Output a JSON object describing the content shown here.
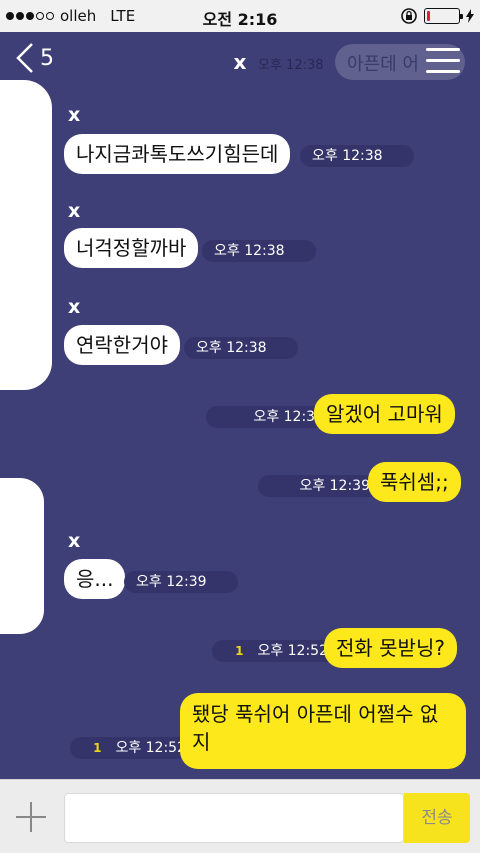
{
  "status_bar": {
    "carrier": "olleh",
    "network": "LTE",
    "time": "오전 2:16",
    "signal_bars": 3,
    "battery_level": 0.1,
    "battery_color": "#e0212a"
  },
  "header": {
    "back_count": "5",
    "title": "x",
    "ghost_text": "아픈데 어",
    "ghost_time": "오후 12:38"
  },
  "messages": [
    {
      "dir": "in",
      "sender": "x",
      "text": "나지금콰톡도쓰기힘든데",
      "time": "오후 12:38"
    },
    {
      "dir": "in",
      "sender": "x",
      "text": "너걱정할까바",
      "time": "오후 12:38"
    },
    {
      "dir": "in",
      "sender": "x",
      "text": "연락한거야",
      "time": "오후 12:38"
    },
    {
      "dir": "out",
      "text": "알겠어 고마워",
      "time": "오후 12:39"
    },
    {
      "dir": "out",
      "text": "푹쉬셈;;",
      "time": "오후 12:39"
    },
    {
      "dir": "in",
      "sender": "x",
      "text": "응...",
      "time": "오후 12:39"
    },
    {
      "dir": "out",
      "text": "전화 못받닝?",
      "time": "오후 12:52",
      "unread": "1"
    },
    {
      "dir": "out",
      "text_line1": "됐당 푹쉬어 아픈데 어쩔수 없",
      "text_line2": "지",
      "time": "오후 12:52",
      "unread": "1"
    }
  ],
  "composer": {
    "send_label": "전송",
    "input_value": ""
  },
  "colors": {
    "chat_background": "#3f3f77",
    "outgoing_bubble": "#fde81b",
    "incoming_bubble": "#ffffff",
    "send_button": "#f6e31e"
  }
}
